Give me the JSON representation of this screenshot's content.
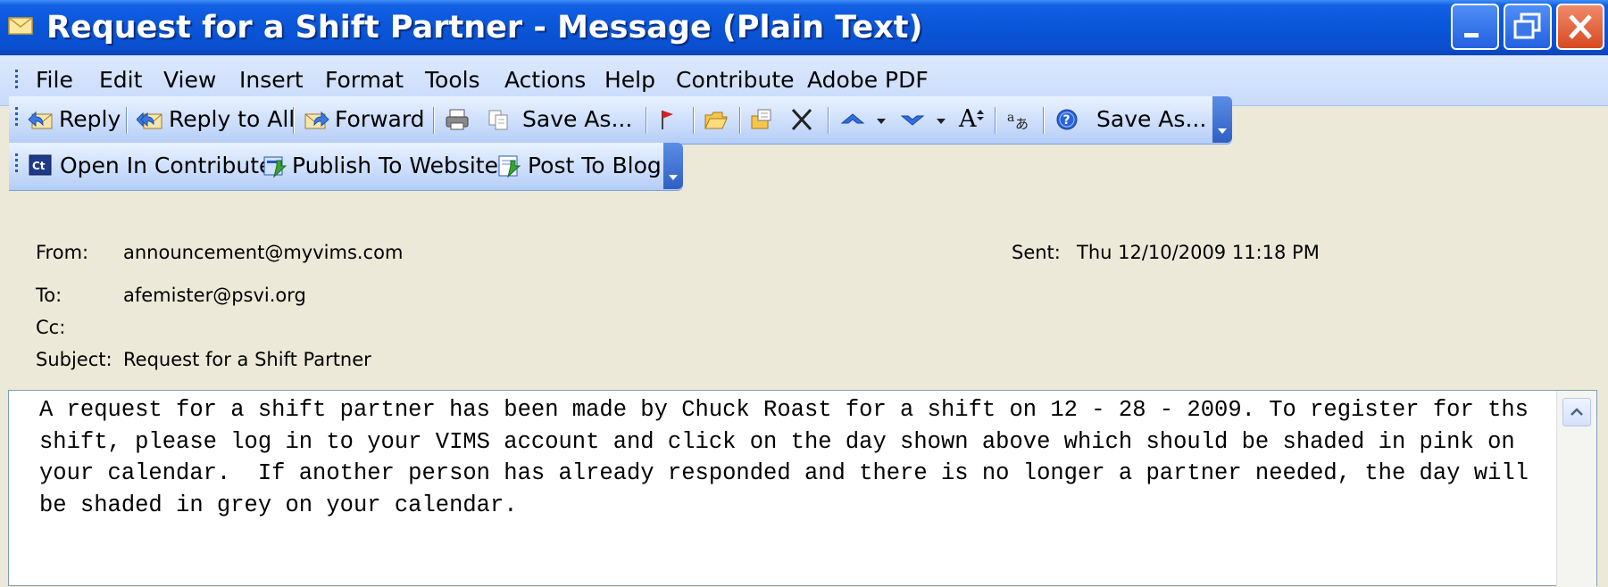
{
  "window": {
    "title": "Request for a Shift Partner - Message (Plain Text)",
    "controls": [
      "minimize",
      "maximize",
      "close"
    ]
  },
  "menu": [
    "File",
    "Edit",
    "View",
    "Insert",
    "Format",
    "Tools",
    "Actions",
    "Help",
    "Contribute",
    "Adobe PDF"
  ],
  "toolbar1": {
    "reply": "Reply",
    "reply_all": "Reply to All",
    "forward": "Forward",
    "save_as": "Save As...",
    "save_as2": "Save As...",
    "font_size": "A",
    "icons": [
      "print-icon",
      "copy-icon",
      "flag-icon",
      "open-folder-icon",
      "move-icon",
      "delete-icon",
      "previous-item-icon",
      "next-item-icon",
      "encoding-icon",
      "help-icon"
    ]
  },
  "toolbar2": {
    "contribute": "Open In Contribute",
    "publish": "Publish To Website",
    "blog": "Post To Blog"
  },
  "header": {
    "from_label": "From:",
    "from_value": "announcement@myvims.com",
    "sent_label": "Sent:",
    "sent_value": "Thu 12/10/2009 11:18 PM",
    "to_label": "To:",
    "to_value": "afemister@psvi.org",
    "cc_label": "Cc:",
    "cc_value": "",
    "subject_label": "Subject:",
    "subject_value": "Request for a Shift Partner"
  },
  "body": {
    "text": "A request for a shift partner has been made by Chuck Roast for a shift on 12 - 28 - 2009. To register for ths shift, please log in to your VIMS account and click on the day shown above which should be shaded in pink on your calendar.  If another person has already responded and there is no longer a partner needed, the day will be shaded in grey on your calendar."
  },
  "colors": {
    "titlebar": "#0a55d8",
    "close_button": "#d74a21",
    "form_background": "#ece9d8",
    "toolbar": "#cfe0fc"
  }
}
